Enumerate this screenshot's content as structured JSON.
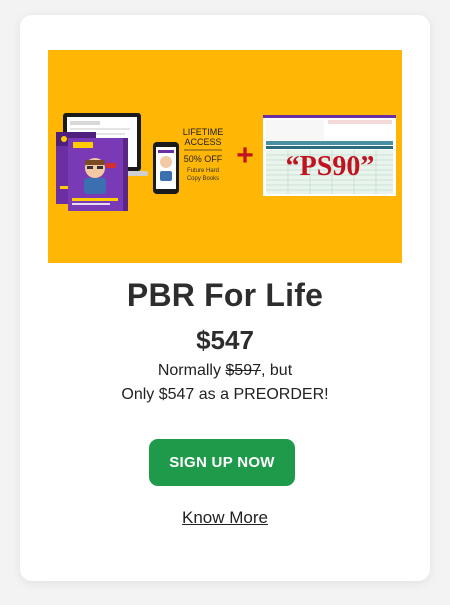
{
  "product": {
    "title": "PBR For Life",
    "price": "$547",
    "normally_prefix": "Normally ",
    "old_price": "$597",
    "normally_suffix": ", but",
    "preorder_line": "Only $547 as a PREORDER!"
  },
  "hero": {
    "lifetime_line1": "LIFETIME",
    "lifetime_line2": "ACCESS",
    "discount": "50% OFF",
    "discount_sub1": "Future Hard",
    "discount_sub2": "Copy Books",
    "plus_sign": "+",
    "badge": "“PS90”"
  },
  "actions": {
    "signup_label": "SIGN UP NOW",
    "know_more_label": "Know More"
  },
  "colors": {
    "hero_bg": "#ffb604",
    "cta_bg": "#1f9a4a",
    "badge_red": "#c1121f",
    "book_purple": "#6b2fa3"
  }
}
